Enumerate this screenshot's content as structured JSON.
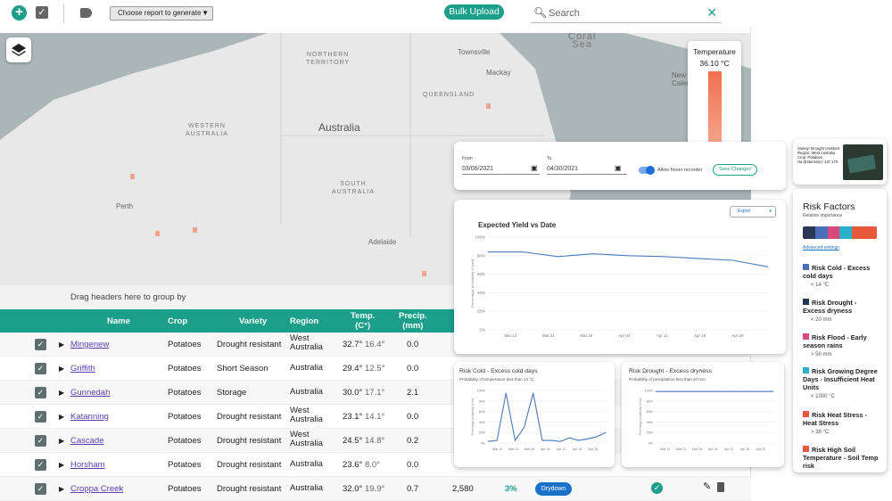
{
  "toolbar": {
    "report_select": "Choose report to generate",
    "bulk_upload": "Bulk Upload",
    "search_placeholder": "Search"
  },
  "map": {
    "labels": {
      "coral_sea": "Coral\nSea",
      "nt": "NORTHERN\nTERRITORY",
      "qld": "QUEENSLAND",
      "wa": "WESTERN\nAUSTRALIA",
      "sa": "SOUTH\nAUSTRALIA",
      "australia": "Australia"
    },
    "cities": {
      "townsville": "Townsville",
      "mackay": "Mackay",
      "perth": "Perth",
      "adelaide": "Adelaide",
      "newcaledonia": "New\nCaledor"
    }
  },
  "temperature": {
    "label": "Temperature",
    "value": "36.10 °C"
  },
  "grid": {
    "group_hint": "Drag headers here to group by",
    "headers": {
      "name": "Name",
      "crop": "Crop",
      "variety": "Variety",
      "region": "Region",
      "temp": "Temp.\n(C°)",
      "precip": "Precip.\n(mm)"
    },
    "rows": [
      {
        "name": "Mingenew",
        "crop": "Potatoes",
        "variety": "Drought resistant",
        "region": "West\nAustralia",
        "t1": "32.7°",
        "t2": "16.4°",
        "p": "0.0"
      },
      {
        "name": "Griffith",
        "crop": "Potatoes",
        "variety": "Short Season",
        "region": "Australia",
        "t1": "29.4°",
        "t2": "12.5°",
        "p": "0.0"
      },
      {
        "name": "Gunnedah",
        "crop": "Potatoes",
        "variety": "Storage",
        "region": "Australia",
        "t1": "30.0°",
        "t2": "17.1°",
        "p": "2.1"
      },
      {
        "name": "Katanning",
        "crop": "Potatoes",
        "variety": "Drought resistant",
        "region": "West\nAustralia",
        "t1": "23.1°",
        "t2": "14.1°",
        "p": "0.0"
      },
      {
        "name": "Cascade",
        "crop": "Potatoes",
        "variety": "Drought resistant",
        "region": "West\nAustralia",
        "t1": "24.5°",
        "t2": "14.8°",
        "p": "0.2"
      },
      {
        "name": "Horsham",
        "crop": "Potatoes",
        "variety": "Drought resistant",
        "region": "Australia",
        "t1": "23.6°",
        "t2": "8.0°",
        "p": "0.0"
      },
      {
        "name": "Croppa Creek",
        "crop": "Potatoes",
        "variety": "Drought resistant",
        "region": "Australia",
        "t1": "32.0°",
        "t2": "19.9°",
        "p": "0.7",
        "yield": "2,580",
        "pct": "3%",
        "status": "Drydown"
      }
    ]
  },
  "dates": {
    "from_label": "From",
    "from": "03/06/2021",
    "to_label": "To",
    "to": "04/30/2021",
    "toggle": "Allow hover recorder",
    "save": "Save Changes"
  },
  "yield_chart": {
    "title": "Expected Yield vs Date",
    "export": "Export",
    "ylabel": "Percentage probability of yield",
    "yticks": [
      "100%",
      "80%",
      "60%",
      "40%",
      "20%",
      "0%"
    ],
    "xticks": [
      "Mar 14",
      "Mar 21",
      "Mar 28",
      "Apr 04",
      "Apr 11",
      "Apr 18",
      "Apr 25"
    ]
  },
  "cold_chart": {
    "title": "Risk Cold - Excess cold days",
    "sub": "Probability of temperature less than 14 °C",
    "ylabel": "Percentage probability of risk",
    "yticks": [
      "100%",
      "80%",
      "60%",
      "40%",
      "20%",
      "0%"
    ],
    "xticks": [
      "Mar 14",
      "Mar 21",
      "Mar 28",
      "Apr 04",
      "Apr 11",
      "Apr 18",
      "Apr 25"
    ]
  },
  "drought_chart": {
    "title": "Risk Drought - Excess dryness",
    "sub": "Probability of precipitation less than 20 mm",
    "ylabel": "Percentage probability of risk",
    "yticks": [
      "100%",
      "80%",
      "60%",
      "40%",
      "20%",
      "0%"
    ],
    "xticks": [
      "Mar 14",
      "Mar 21",
      "Mar 28",
      "Apr 04",
      "Apr 11",
      "Apr 18",
      "Apr 25"
    ]
  },
  "chart_data": [
    {
      "type": "line",
      "title": "Expected Yield vs Date",
      "ylabel": "Percentage probability of yield",
      "ylim": [
        0,
        100
      ],
      "x": [
        "Mar 08",
        "Mar 14",
        "Mar 21",
        "Mar 28",
        "Apr 04",
        "Apr 11",
        "Apr 18",
        "Apr 25",
        "Apr 30"
      ],
      "values": [
        84,
        84,
        79,
        82,
        80,
        79,
        77,
        75,
        68
      ]
    },
    {
      "type": "line",
      "title": "Risk Cold - Excess cold days",
      "ylabel": "Percentage probability of risk",
      "ylim": [
        0,
        100
      ],
      "x": [
        "Mar 08",
        "Mar 12",
        "Mar 13",
        "Mar 14",
        "Mar 16",
        "Mar 17",
        "Mar 19",
        "Mar 21",
        "Mar 28",
        "Apr 04",
        "Apr 11",
        "Apr 18",
        "Apr 25",
        "Apr 30"
      ],
      "values": [
        3,
        5,
        95,
        5,
        30,
        95,
        5,
        5,
        3,
        10,
        5,
        8,
        12,
        20
      ]
    },
    {
      "type": "line",
      "title": "Risk Drought - Excess dryness",
      "ylabel": "Percentage probability of risk",
      "ylim": [
        0,
        100
      ],
      "x": [
        "Mar 08",
        "Mar 14",
        "Mar 21",
        "Mar 28",
        "Apr 04",
        "Apr 11",
        "Apr 18",
        "Apr 25",
        "Apr 30"
      ],
      "values": [
        98,
        98,
        98,
        98,
        98,
        98,
        98,
        98,
        98
      ]
    }
  ],
  "farm": {
    "variety": "Variety: Drought resistant",
    "region": "Region: West Australia",
    "crop": "Crop: Potatoes",
    "ha": "Ha (Extension): 137.170"
  },
  "risk": {
    "title": "Risk Factors",
    "sub": "Relative importance",
    "advanced": "Advanced settings",
    "items": [
      {
        "label": "Risk Cold - Excess cold days",
        "sub": "< 14 °C",
        "color": "#4a6fb8"
      },
      {
        "label": "Risk Drought - Excess dryness",
        "sub": "< 20 mm",
        "color": "#2a3754"
      },
      {
        "label": "Risk Flood - Early season rains",
        "sub": "> 50 mm",
        "color": "#d94a7a"
      },
      {
        "label": "Risk Growing Degree Days - Insufficient Heat Units",
        "sub": "< 1000 °C",
        "color": "#2ab0c8"
      },
      {
        "label": "Risk Heat Stress - Heat Stress",
        "sub": "> 38 °C",
        "color": "#e8583a"
      },
      {
        "label": "Risk High Soil Temperature - Soil Temp risk",
        "sub": "",
        "color": "#e8583a"
      }
    ],
    "bar_colors": [
      "#2a3754",
      "#4a6fb8",
      "#d94a7a",
      "#2ab0c8",
      "#e8583a",
      "#e8583a"
    ]
  }
}
